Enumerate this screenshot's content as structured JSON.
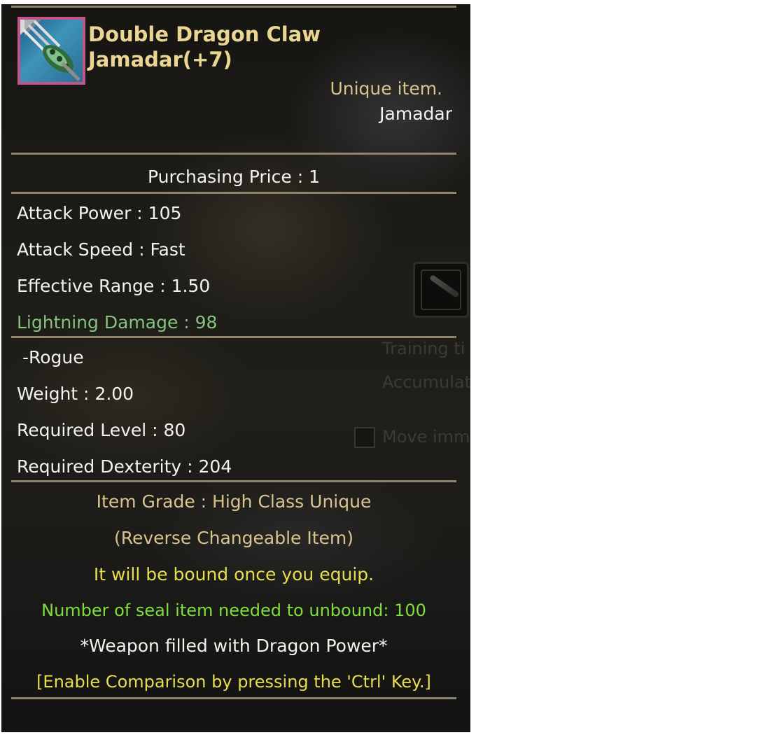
{
  "item": {
    "icon": "jamadar-claw-weapon-icon",
    "name_line1": "Double Dragon Claw",
    "name_line2": "Jamadar(+7)",
    "rarity": "Unique item.",
    "type": "Jamadar"
  },
  "price": {
    "text": "Purchasing Price : 1"
  },
  "stats": {
    "attack_power": "Attack Power : 105",
    "attack_speed": "Attack Speed : Fast",
    "effective_range": "Effective Range : 1.50",
    "lightning_damage": "Lightning Damage : 98"
  },
  "requirements": {
    "class": " -Rogue",
    "weight": "Weight : 2.00",
    "level": "Required Level : 80",
    "dexterity": "Required Dexterity : 204"
  },
  "notes": {
    "grade": "Item Grade : High Class Unique",
    "reverse": "(Reverse Changeable Item)",
    "bound": "It will be bound once you equip.",
    "unbound": "Number of seal item needed to unbound: 100",
    "dragon_power": "*Weapon filled with Dragon Power*",
    "compare": "[Enable Comparison by pressing the 'Ctrl' Key.]"
  },
  "background_ui": {
    "training": "Training ti",
    "accumulate": "Accumulat",
    "move": "Move imm"
  },
  "colors": {
    "name": "#ead593",
    "white": "#f3f2ee",
    "gold": "#d9c48e",
    "green_light": "#84c27e",
    "yellow": "#e7dd4f",
    "green": "#7fdd3c",
    "divider": "#8f8369"
  }
}
